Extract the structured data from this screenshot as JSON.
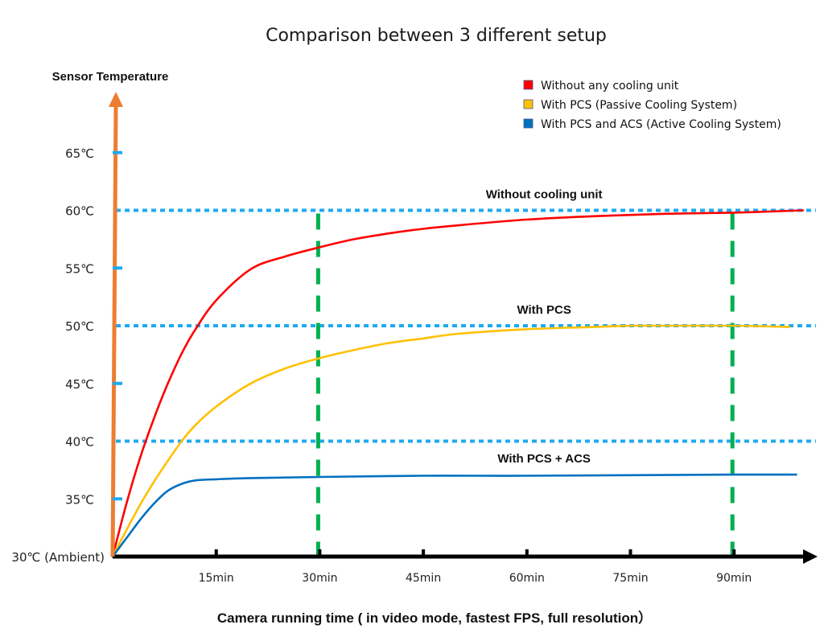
{
  "chart_data": {
    "type": "line",
    "title": "Comparison between 3 different setup",
    "ylabel": "Sensor Temperature",
    "xlabel": "Camera running time ( in video mode, fastest FPS, full resolution）",
    "xunit": "min",
    "ylim": [
      30,
      68
    ],
    "xlim": [
      0,
      102
    ],
    "grid": false,
    "legend_position": "top-right",
    "y_ticks": [
      {
        "value": 30,
        "label": "30℃ (Ambient)"
      },
      {
        "value": 35,
        "label": "35℃"
      },
      {
        "value": 40,
        "label": "40℃"
      },
      {
        "value": 45,
        "label": "45℃"
      },
      {
        "value": 50,
        "label": "50℃"
      },
      {
        "value": 55,
        "label": "55℃"
      },
      {
        "value": 60,
        "label": "60℃"
      },
      {
        "value": 65,
        "label": "65℃"
      }
    ],
    "x_ticks": [
      {
        "value": 15,
        "label": "15min"
      },
      {
        "value": 30,
        "label": "30min"
      },
      {
        "value": 45,
        "label": "45min"
      },
      {
        "value": 60,
        "label": "60min"
      },
      {
        "value": 75,
        "label": "75min"
      },
      {
        "value": 90,
        "label": "90min"
      }
    ],
    "reference_lines_horizontal": [
      {
        "value": 60,
        "label": "Without cooling unit",
        "color": "#1eaaf1"
      },
      {
        "value": 50,
        "label": "With PCS",
        "color": "#1eaaf1"
      },
      {
        "value": 40,
        "label": "",
        "color": "#1eaaf1"
      }
    ],
    "reference_lines_vertical": [
      {
        "value": 30,
        "color": "#00b050"
      },
      {
        "value": 90,
        "color": "#00b050"
      }
    ],
    "annotations": [
      {
        "text": "Without cooling unit",
        "x": 52,
        "y": 61.2
      },
      {
        "text": "With PCS",
        "x": 52,
        "y": 51.2
      },
      {
        "text": "With PCS + ACS",
        "x": 52,
        "y": 38.3
      }
    ],
    "series": [
      {
        "name": "Without any cooling unit",
        "color": "#ff0000",
        "x": [
          0,
          2,
          4,
          6,
          8,
          10,
          12,
          15,
          20,
          25,
          30,
          35,
          40,
          45,
          50,
          60,
          70,
          80,
          90,
          100
        ],
        "y": [
          30,
          34.6,
          38.6,
          42.0,
          45.0,
          47.6,
          49.7,
          52.2,
          54.9,
          56.0,
          56.8,
          57.5,
          58.0,
          58.4,
          58.7,
          59.2,
          59.5,
          59.7,
          59.8,
          60.0
        ]
      },
      {
        "name": "With PCS (Passive Cooling System)",
        "color": "#ffc000",
        "x": [
          0,
          2,
          4,
          6,
          8,
          10,
          12,
          15,
          20,
          25,
          30,
          35,
          40,
          45,
          50,
          60,
          70,
          75,
          80,
          90,
          98
        ],
        "y": [
          30,
          32.3,
          34.5,
          36.5,
          38.3,
          40.0,
          41.4,
          43.0,
          45.0,
          46.3,
          47.2,
          47.9,
          48.5,
          48.9,
          49.3,
          49.7,
          49.9,
          50.0,
          50.0,
          50.0,
          49.9
        ]
      },
      {
        "name": "With PCS and ACS (Active Cooling System)",
        "color": "#0070c0",
        "x": [
          0,
          2,
          4,
          6,
          8,
          10,
          12,
          15,
          20,
          30,
          45,
          60,
          75,
          90,
          99
        ],
        "y": [
          30,
          31.6,
          33.2,
          34.6,
          35.7,
          36.3,
          36.6,
          36.7,
          36.8,
          36.9,
          37.0,
          37.0,
          37.05,
          37.1,
          37.1
        ]
      }
    ]
  }
}
